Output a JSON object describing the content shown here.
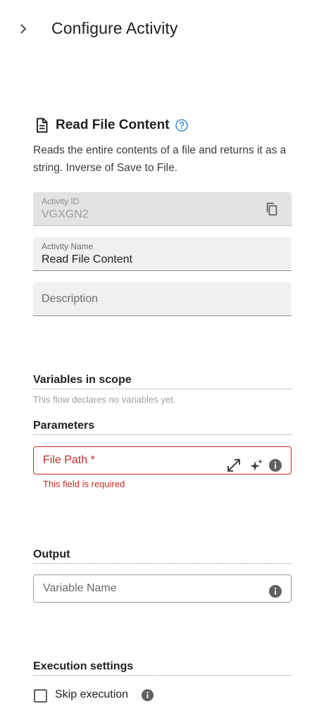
{
  "header": {
    "title": "Configure Activity"
  },
  "activity": {
    "title": "Read File Content",
    "description": "Reads the entire contents of a file and returns it as a string. Inverse of Save to File."
  },
  "fields": {
    "activity_id": {
      "label": "Activity ID",
      "value": "VGXGN2"
    },
    "activity_name": {
      "label": "Activity Name",
      "value": "Read File Content"
    },
    "description": {
      "placeholder": "Description"
    }
  },
  "variables": {
    "heading": "Variables in scope",
    "empty_text": "This flow declares no variables yet."
  },
  "parameters": {
    "heading": "Parameters",
    "file_path": {
      "label": "File Path *",
      "error": "This field is required"
    }
  },
  "output": {
    "heading": "Output",
    "variable_name": {
      "placeholder": "Variable Name"
    }
  },
  "execution": {
    "heading": "Execution settings",
    "skip_label": "Skip execution",
    "skip_checked": false
  },
  "colors": {
    "error": "#c62828",
    "help": "#3f8fd6",
    "field_bg": "#f0f0f0"
  },
  "icons": [
    "chevron-right-icon",
    "document-icon",
    "help-icon",
    "copy-icon",
    "expand-icon",
    "sparkle-icon",
    "info-icon",
    "checkbox"
  ]
}
